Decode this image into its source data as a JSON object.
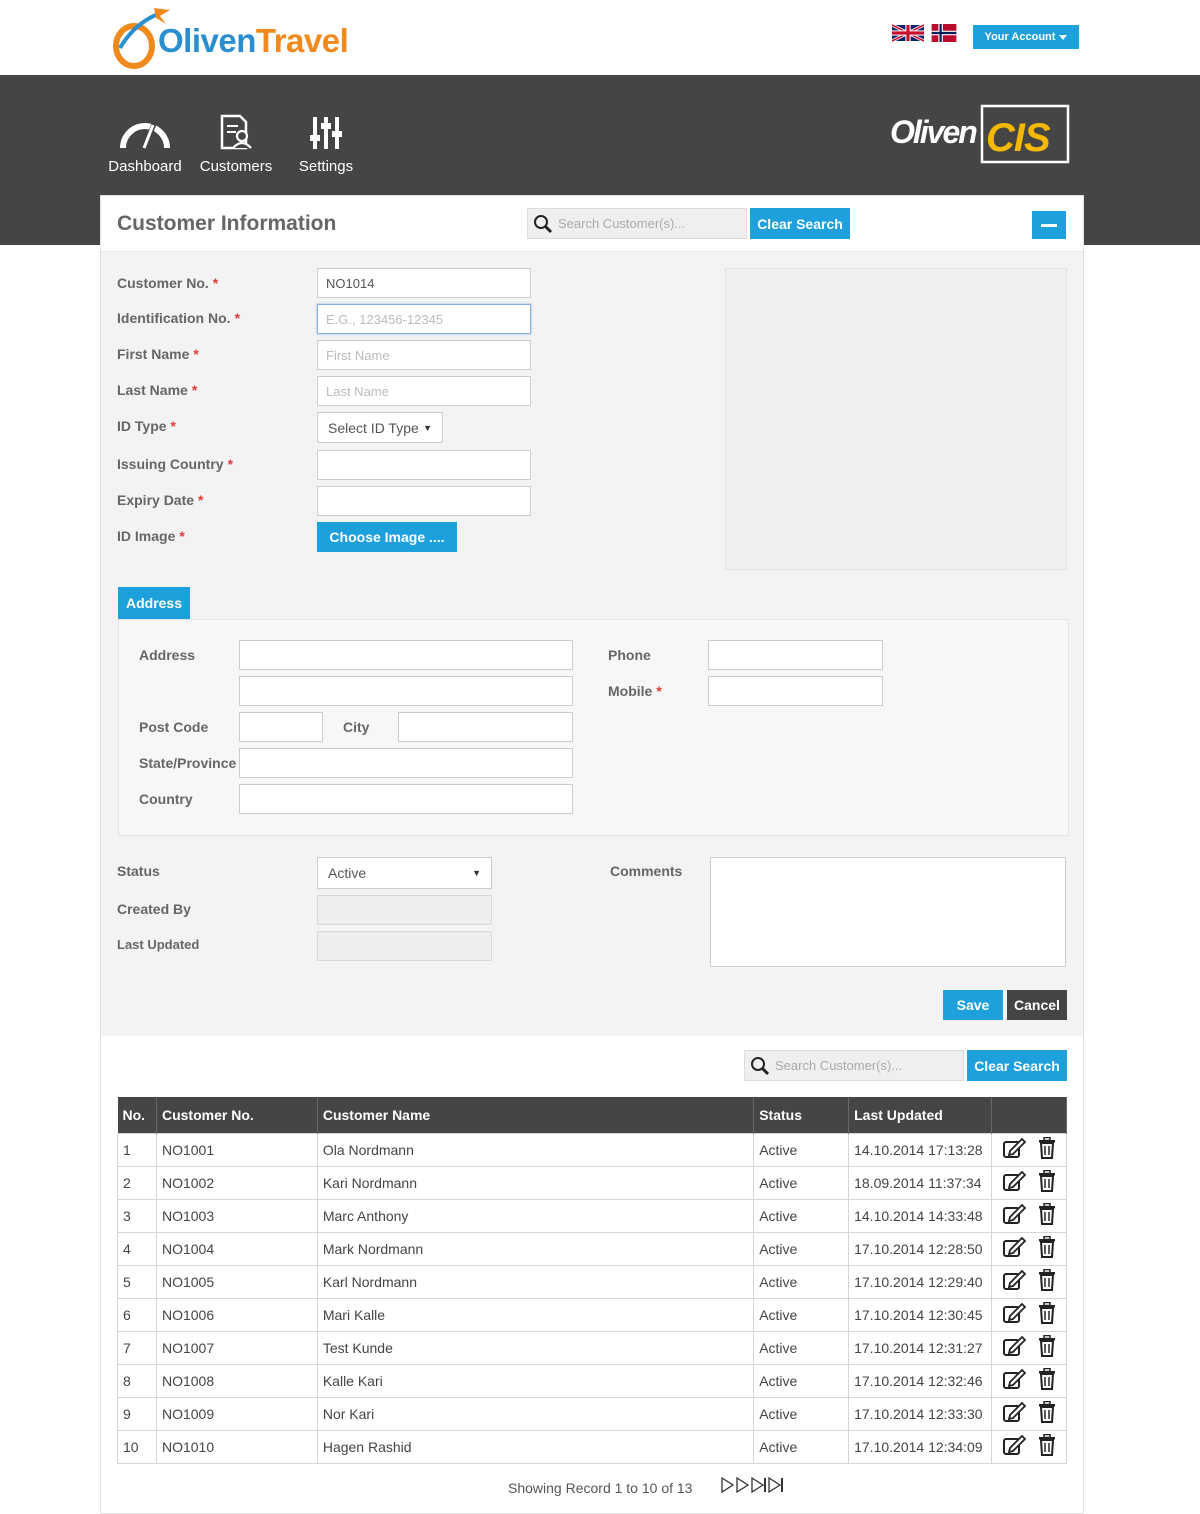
{
  "brand": {
    "part1": "Oliven",
    "part2": "Travel",
    "product_logo": "OlivenCIS"
  },
  "header": {
    "account_label": "Your Account"
  },
  "nav": {
    "items": [
      {
        "label": "Dashboard",
        "icon": "gauge-icon"
      },
      {
        "label": "Customers",
        "icon": "customer-file-icon"
      },
      {
        "label": "Settings",
        "icon": "sliders-icon"
      }
    ]
  },
  "panel": {
    "title": "Customer Information",
    "search_placeholder": "Search Customer(s)...",
    "clear_search": "Clear Search"
  },
  "form": {
    "customer_no": {
      "label": "Customer No.",
      "value": "NO1014"
    },
    "identification_no": {
      "label": "Identification No.",
      "placeholder": "E.G., 123456-12345"
    },
    "first_name": {
      "label": "First Name",
      "placeholder": "First Name"
    },
    "last_name": {
      "label": "Last Name",
      "placeholder": "Last Name"
    },
    "id_type": {
      "label": "ID Type",
      "value": "Select ID Type"
    },
    "issuing_country": {
      "label": "Issuing Country"
    },
    "expiry_date": {
      "label": "Expiry Date"
    },
    "id_image": {
      "label": "ID Image",
      "button": "Choose Image ...."
    },
    "required_mark": "*"
  },
  "address": {
    "tab": "Address",
    "address_label": "Address",
    "post_code_label": "Post Code",
    "city_label": "City",
    "state_label": "State/Province",
    "country_label": "Country",
    "phone_label": "Phone",
    "mobile_label": "Mobile"
  },
  "meta": {
    "status_label": "Status",
    "status_value": "Active",
    "created_by_label": "Created By",
    "last_updated_label": "Last Updated",
    "comments_label": "Comments",
    "save": "Save",
    "cancel": "Cancel"
  },
  "list": {
    "search_placeholder": "Search Customer(s)...",
    "clear_search": "Clear Search",
    "columns": [
      "No.",
      "Customer No.",
      "Customer Name",
      "Status",
      "Last Updated"
    ],
    "rows": [
      [
        "1",
        "NO1001",
        "Ola Nordmann",
        "Active",
        "14.10.2014 17:13:28"
      ],
      [
        "2",
        "NO1002",
        "Kari Nordmann",
        "Active",
        "18.09.2014 11:37:34"
      ],
      [
        "3",
        "NO1003",
        "Marc Anthony",
        "Active",
        "14.10.2014 14:33:48"
      ],
      [
        "4",
        "NO1004",
        "Mark Nordmann",
        "Active",
        "17.10.2014 12:28:50"
      ],
      [
        "5",
        "NO1005",
        "Karl Nordmann",
        "Active",
        "17.10.2014 12:29:40"
      ],
      [
        "6",
        "NO1006",
        "Mari Kalle",
        "Active",
        "17.10.2014 12:30:45"
      ],
      [
        "7",
        "NO1007",
        "Test Kunde",
        "Active",
        "17.10.2014 12:31:27"
      ],
      [
        "8",
        "NO1008",
        "Kalle Kari",
        "Active",
        "17.10.2014 12:32:46"
      ],
      [
        "9",
        "NO1009",
        "Nor Kari",
        "Active",
        "17.10.2014 12:33:30"
      ],
      [
        "10",
        "NO1010",
        "Hagen Rashid",
        "Active",
        "17.10.2014 12:34:09"
      ]
    ],
    "pager_text": "Showing Record 1 to 10 of 13"
  },
  "colors": {
    "accent": "#1ea0dc",
    "dark": "#454545",
    "brand_blue": "#2a8fd1",
    "brand_orange": "#f08a1c",
    "required": "#e03b3b"
  }
}
